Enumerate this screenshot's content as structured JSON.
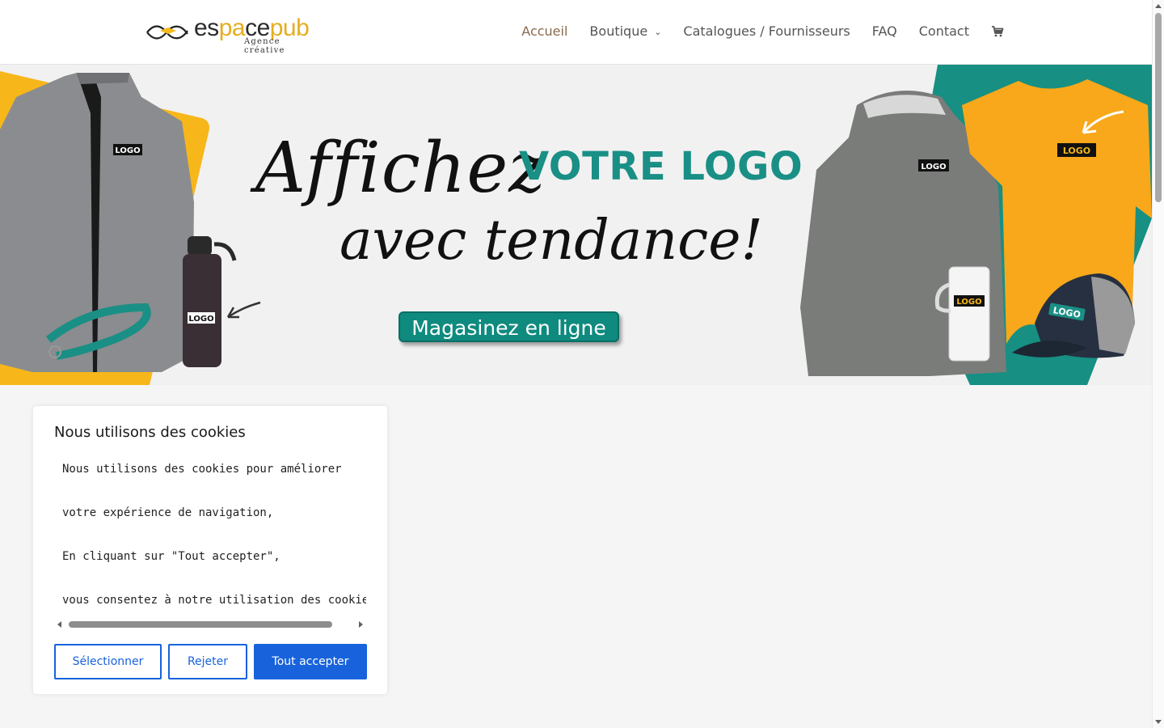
{
  "brand": {
    "name_part1": "es",
    "name_accent1": "pa",
    "name_part2": "ce",
    "name_accent2": "pub",
    "tagline": "Agence créative"
  },
  "nav": {
    "items": [
      {
        "label": "Accueil",
        "active": true
      },
      {
        "label": "Boutique",
        "has_dropdown": true
      },
      {
        "label": "Catalogues / Fournisseurs"
      },
      {
        "label": "FAQ"
      },
      {
        "label": "Contact"
      }
    ],
    "cart_icon": "shopping-cart-icon"
  },
  "hero": {
    "line1": "Affichez",
    "highlight": "VOTRE LOGO",
    "line2": "avec tendance!",
    "cta": "Magasinez en ligne",
    "product_badge": "LOGO"
  },
  "cookie": {
    "title": "Nous utilisons des cookies",
    "lines": [
      "Nous utilisons des cookies pour améliorer",
      "votre expérience de navigation,",
      "En cliquant sur \"Tout accepter\",",
      "vous consentez à notre utilisation des cookies."
    ],
    "buttons": {
      "select": "Sélectionner",
      "reject": "Rejeter",
      "accept": "Tout accepter"
    }
  },
  "colors": {
    "nav_active": "#8a6a4e",
    "brand_teal": "#1a8f85",
    "brand_yellow": "#f5b81c",
    "accept_blue": "#1863dc"
  }
}
